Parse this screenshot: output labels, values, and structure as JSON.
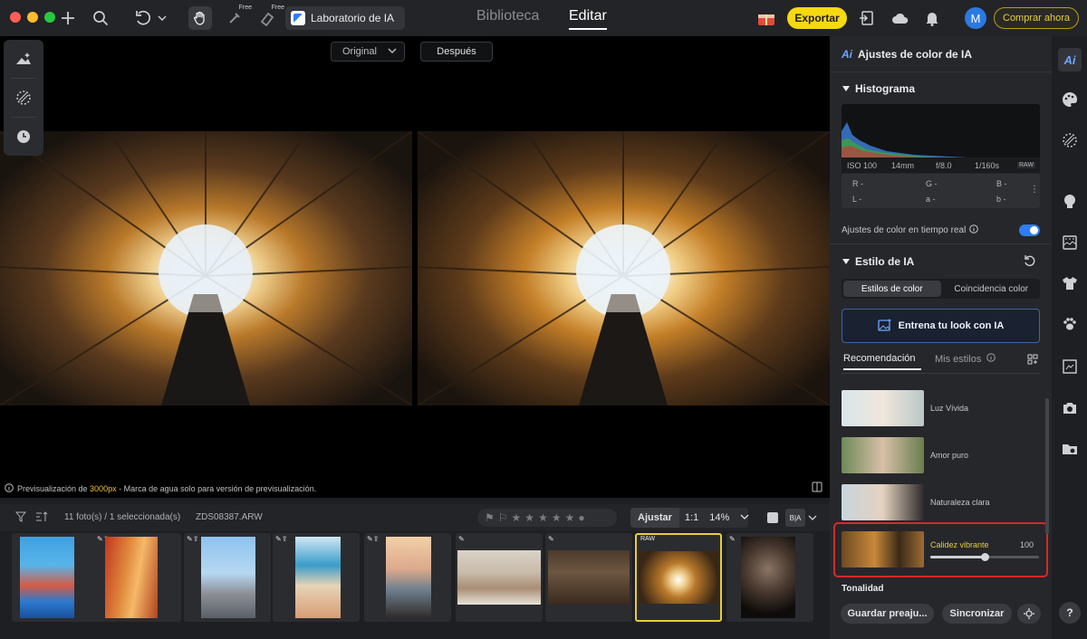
{
  "topbar": {
    "free_label_1": "Free",
    "free_label_2": "Free",
    "ai_lab": "Laboratorio de IA",
    "tab_library": "Biblioteca",
    "tab_edit": "Editar",
    "export": "Exportar",
    "avatar_initial": "M",
    "buy_now": "Comprar ahora"
  },
  "canvas": {
    "view_mode": "Original",
    "after_label": "Después",
    "preview_note_prefix": "Previsualización de ",
    "preview_note_size": "3000px",
    "preview_note_suffix": " - Marca de agua solo para versión de previsualización."
  },
  "filmstrip": {
    "count": "11 foto(s) / 1 seleccionada(s)",
    "filename": "ZDS08387.ARW",
    "fit": "Ajustar",
    "ratio": "1:1",
    "zoom": "14%",
    "raw_tag": "RAW",
    "ba_label": "B|A"
  },
  "panel": {
    "header": "Ajustes de color de IA",
    "ai_badge": "Ai",
    "histogram_title": "Histograma",
    "exif": {
      "iso": "ISO 100",
      "focal": "14mm",
      "aperture": "f/8.0",
      "shutter": "1/160s",
      "format": "RAW"
    },
    "rgb": {
      "r": "R -",
      "g": "G -",
      "b": "B -",
      "l": "L -",
      "a": "a -",
      "b2": "b -"
    },
    "realtime_label": "Ajustes de color en tiempo real",
    "ai_style_title": "Estilo de IA",
    "seg_color_styles": "Estilos de color",
    "seg_color_match": "Coincidencia color",
    "train_button": "Entrena tu look con IA",
    "tab_recommended": "Recomendación",
    "tab_my_styles": "Mis estilos",
    "styles": [
      {
        "label": "Luz Vívida"
      },
      {
        "label": "Amor puro"
      },
      {
        "label": "Naturaleza clara"
      },
      {
        "label": "Calidez vibrante",
        "value": "100"
      }
    ],
    "tonality": "Tonalidad",
    "save_preset": "Guardar preaju...",
    "sync": "Sincronizar"
  },
  "rail": {
    "help": "?"
  }
}
